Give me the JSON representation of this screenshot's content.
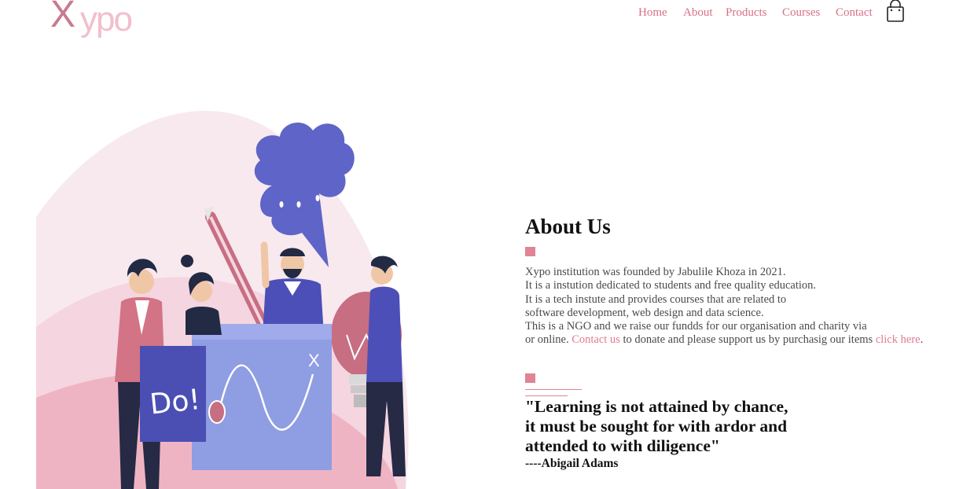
{
  "brand": {
    "logo_x": "X",
    "logo_rest": "ypo"
  },
  "nav": {
    "links": [
      {
        "label": "Home"
      },
      {
        "label": "About"
      },
      {
        "label": "Products"
      },
      {
        "label": "Courses"
      },
      {
        "label": "Contact"
      }
    ],
    "cart_icon": "shopping-bag-icon"
  },
  "hero": {
    "illustration": "team-brainstorm-illustration",
    "sign_text": "Do!",
    "board_mark": "X"
  },
  "about": {
    "title": "About Us",
    "lines": [
      "Xypo institution was founded by Jabulile Khoza in 2021.",
      "It is a instution dedicated to students and free quality education.",
      "It is a tech instute and provides courses that are related to",
      "software development, web design and data science.",
      "This is a NGO and we raise our fundds for our organisation and charity via"
    ],
    "last_line": {
      "pre": "or online. ",
      "link1": "Contact us",
      "mid": " to donate and please support us by purchasig our items ",
      "link2": "click here",
      "post": "."
    }
  },
  "quote": {
    "lines": [
      "\"Learning is not attained by chance,",
      "it must be sought for with ardor and",
      "attended to with diligence\""
    ],
    "author": "----Abigail Adams"
  },
  "colors": {
    "accent": "#e08496",
    "link": "#d86f86",
    "logo_dark": "#c77b8f",
    "logo_light": "#f2bfcb"
  }
}
